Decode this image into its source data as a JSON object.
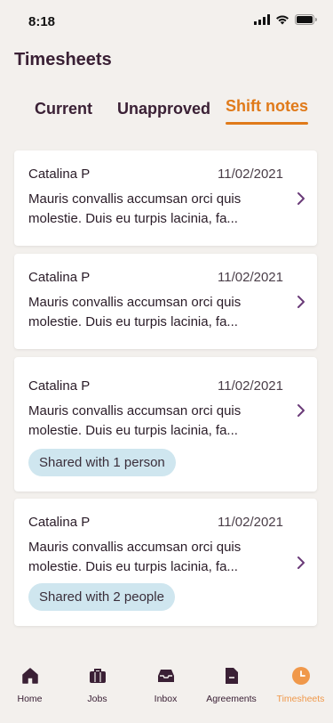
{
  "status_bar": {
    "time": "8:18"
  },
  "header": {
    "title": "Timesheets"
  },
  "tabs": [
    {
      "label": "Current"
    },
    {
      "label": "Unapproved"
    },
    {
      "label": "Shift notes"
    }
  ],
  "cards": [
    {
      "name": "Catalina P",
      "date": "11/02/2021",
      "text": "Mauris convallis accumsan orci quis molestie. Duis eu turpis lacinia, fa...",
      "shared": ""
    },
    {
      "name": "Catalina P",
      "date": "11/02/2021",
      "text": "Mauris convallis accumsan orci quis molestie. Duis eu turpis lacinia, fa...",
      "shared": ""
    },
    {
      "name": "Catalina P",
      "date": "11/02/2021",
      "text": "Mauris convallis accumsan orci quis molestie. Duis eu turpis lacinia, fa...",
      "shared": "Shared with 1 person"
    },
    {
      "name": "Catalina P",
      "date": "11/02/2021",
      "text": "Mauris convallis accumsan orci quis molestie. Duis eu turpis lacinia, fa...",
      "shared": "Shared with 2 people"
    }
  ],
  "bottom_nav": [
    {
      "label": "Home",
      "icon": "home-icon"
    },
    {
      "label": "Jobs",
      "icon": "briefcase-icon"
    },
    {
      "label": "Inbox",
      "icon": "inbox-icon"
    },
    {
      "label": "Agreements",
      "icon": "document-icon"
    },
    {
      "label": "Timesheets",
      "icon": "clock-icon"
    }
  ],
  "colors": {
    "accent": "#e07a1a",
    "nav_active": "#f0984a",
    "text_primary": "#3a2035",
    "badge_bg": "#cfe6ef",
    "background": "#f3f0ed"
  }
}
